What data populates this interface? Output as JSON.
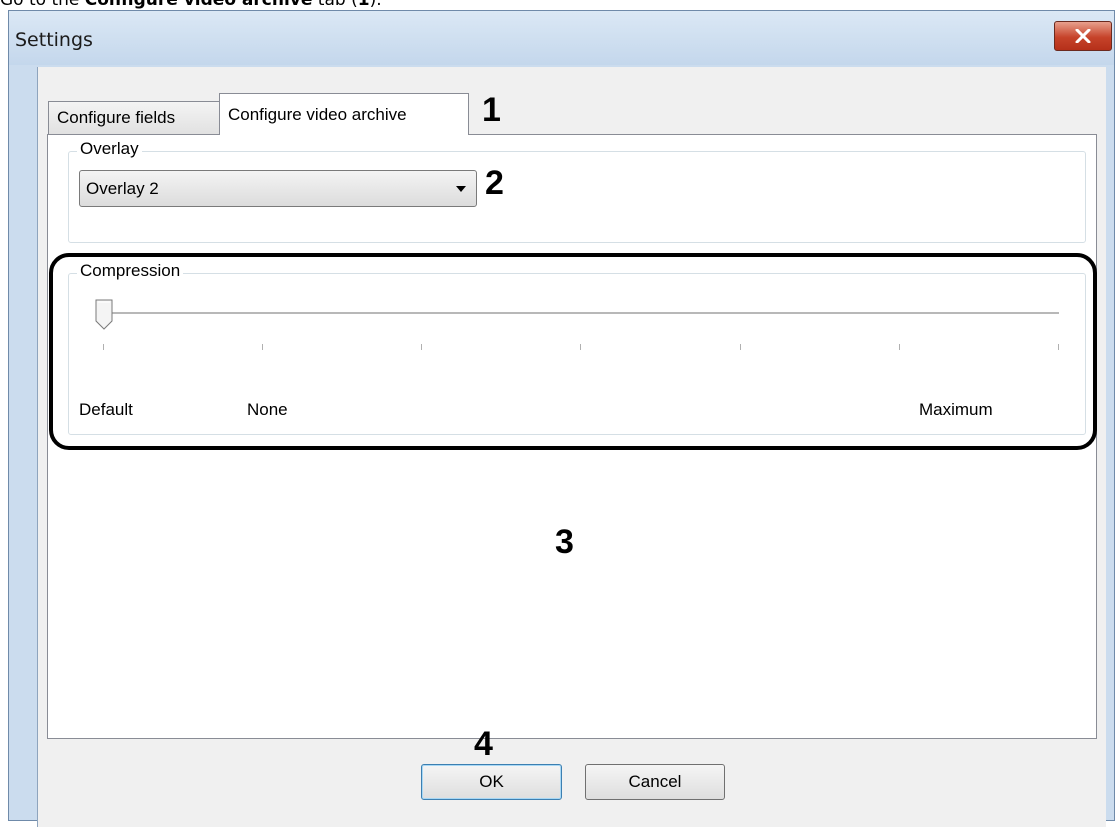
{
  "doc_text": {
    "prefix": "Go to the ",
    "bold": "Configure video archive",
    "suffix_1": " tab (",
    "bold_num": "1",
    "suffix_2": ")."
  },
  "window": {
    "title": "Settings"
  },
  "tabs": [
    {
      "label": "Configure fields"
    },
    {
      "label": "Configure video archive"
    }
  ],
  "overlay": {
    "group_label": "Overlay",
    "selected": "Overlay 2"
  },
  "compression": {
    "group_label": "Compression",
    "slider_value_index": 0,
    "tick_count": 7,
    "labels": {
      "default": "Default",
      "none": "None",
      "maximum": "Maximum"
    }
  },
  "annotations": {
    "n1": "1",
    "n2": "2",
    "n3": "3",
    "n4": "4"
  },
  "buttons": {
    "ok": "OK",
    "cancel": "Cancel"
  },
  "colors": {
    "close_button": "#c6432a",
    "window_frame": "#cbdcee",
    "default_button_border": "#3c7fb1"
  }
}
